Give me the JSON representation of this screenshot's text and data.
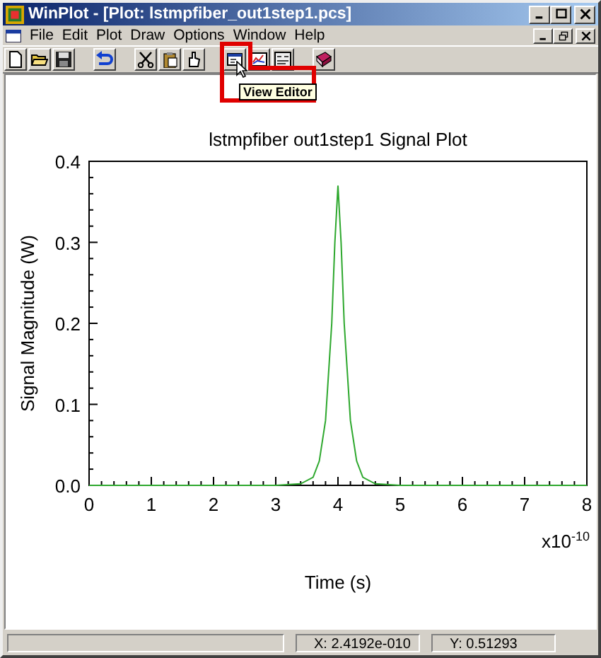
{
  "window": {
    "title": "WinPlot - [Plot: lstmpfiber_out1step1.pcs]"
  },
  "menu": [
    "File",
    "Edit",
    "Plot",
    "Draw",
    "Options",
    "Window",
    "Help"
  ],
  "toolbar": [
    [
      {
        "kind": "new"
      },
      {
        "kind": "open"
      },
      {
        "kind": "save"
      }
    ],
    [
      {
        "kind": "undo"
      }
    ],
    [
      {
        "kind": "cut"
      },
      {
        "kind": "paste"
      },
      {
        "kind": "hand"
      }
    ],
    [
      {
        "kind": "window"
      },
      {
        "kind": "chart"
      },
      {
        "kind": "redraw"
      }
    ],
    [
      {
        "kind": "book"
      }
    ]
  ],
  "tooltip": {
    "text": "View Editor"
  },
  "plot": {
    "chart_data": {
      "type": "line",
      "title": "lstmpfiber out1step1 Signal Plot",
      "xlabel": "Time (s)",
      "ylabel": "Signal Magnitude (W)",
      "x": [
        0,
        1,
        2,
        3,
        3.4,
        3.6,
        3.7,
        3.8,
        3.9,
        3.95,
        4.0,
        4.05,
        4.1,
        4.2,
        4.3,
        4.4,
        4.6,
        5,
        6,
        7,
        8
      ],
      "series": [
        {
          "color": "#2ea82e",
          "values": [
            0,
            0,
            0,
            0,
            0.002,
            0.01,
            0.03,
            0.08,
            0.2,
            0.3,
            0.37,
            0.3,
            0.2,
            0.08,
            0.03,
            0.01,
            0.002,
            0,
            0,
            0,
            0
          ]
        }
      ],
      "xlim": [
        0,
        8
      ],
      "ylim": [
        0,
        0.4
      ],
      "xticks": [
        0,
        1,
        2,
        3,
        4,
        5,
        6,
        7,
        8
      ],
      "yticks": [
        {
          "value": 0,
          "label": "0.0"
        },
        {
          "value": 0.1,
          "label": "0.1"
        },
        {
          "value": 0.2,
          "label": "0.2"
        },
        {
          "value": 0.3,
          "label": "0.3"
        },
        {
          "value": 0.4,
          "label": "0.4"
        }
      ],
      "annotations": [
        {
          "text": "x10$^{-10}$"
        }
      ]
    }
  },
  "status_bar": {
    "x": "X: 2.4192e-010",
    "y": "Y: 0.51293"
  }
}
